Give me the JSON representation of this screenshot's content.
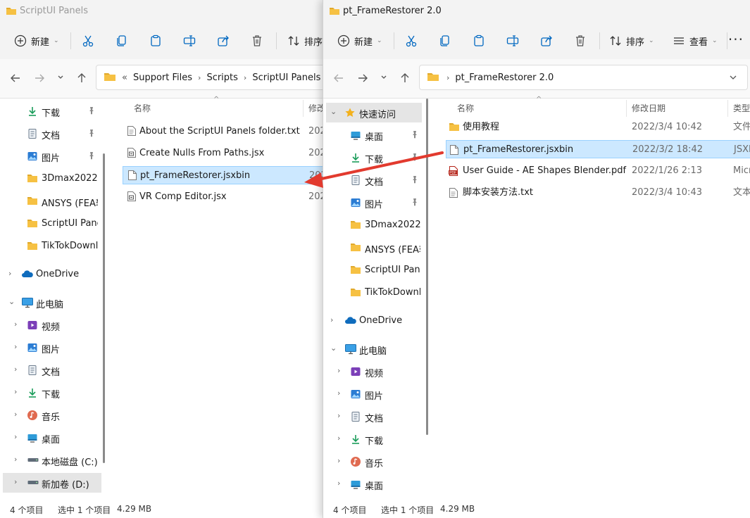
{
  "colors": {
    "accent": "#0078d4",
    "folder": "#f6c143",
    "arrow": "#e23a2e",
    "selection": "#cce8ff"
  },
  "left": {
    "title": "ScriptUI Panels",
    "toolbar": {
      "new_label": "新建",
      "sort_label": "排序"
    },
    "breadcrumb": {
      "prefix": "«",
      "items": [
        "Support Files",
        "Scripts",
        "ScriptUI Panels"
      ]
    },
    "nav": [
      {
        "label": "下载",
        "icon": "download-icon",
        "pinned": true
      },
      {
        "label": "文档",
        "icon": "document-icon",
        "pinned": true
      },
      {
        "label": "图片",
        "icon": "picture-icon",
        "pinned": true
      },
      {
        "label": "3Dmax2022",
        "icon": "folder-icon"
      },
      {
        "label": "ANSYS (FEA软",
        "icon": "folder-icon"
      },
      {
        "label": "ScriptUI Panel",
        "icon": "folder-icon"
      },
      {
        "label": "TikTokDownlc",
        "icon": "folder-icon"
      },
      {
        "label": "OneDrive",
        "icon": "cloud-icon"
      },
      {
        "label": "此电脑",
        "icon": "pc-icon"
      },
      {
        "label": "视频",
        "icon": "video-icon"
      },
      {
        "label": "图片",
        "icon": "picture-icon"
      },
      {
        "label": "文档",
        "icon": "document-icon"
      },
      {
        "label": "下载",
        "icon": "download-icon"
      },
      {
        "label": "音乐",
        "icon": "music-icon"
      },
      {
        "label": "桌面",
        "icon": "desktop-icon"
      },
      {
        "label": "本地磁盘 (C:)",
        "icon": "drive-icon"
      },
      {
        "label": "新加卷 (D:)",
        "icon": "drive-icon"
      }
    ],
    "columns": {
      "name": "名称",
      "modified": "修改"
    },
    "files": [
      {
        "name": "About the ScriptUI Panels folder.txt",
        "date": "202",
        "icon": "text-file-icon"
      },
      {
        "name": "Create Nulls From Paths.jsx",
        "date": "202",
        "icon": "script-file-icon"
      },
      {
        "name": "pt_FrameRestorer.jsxbin",
        "date": "202",
        "icon": "blank-file-icon",
        "selected": true
      },
      {
        "name": "VR Comp Editor.jsx",
        "date": "202",
        "icon": "script-file-icon"
      }
    ],
    "status": {
      "count": "4 个项目",
      "selected": "选中 1 个项目",
      "size": "4.29 MB"
    }
  },
  "right": {
    "title": "pt_FrameRestorer 2.0",
    "toolbar": {
      "new_label": "新建",
      "sort_label": "排序",
      "view_label": "查看"
    },
    "breadcrumb": {
      "items": [
        "pt_FrameRestorer 2.0"
      ]
    },
    "nav": [
      {
        "label": "快速访问",
        "icon": "star-icon"
      },
      {
        "label": "桌面",
        "icon": "desktop-icon",
        "pinned": true
      },
      {
        "label": "下载",
        "icon": "download-icon",
        "pinned": true
      },
      {
        "label": "文档",
        "icon": "document-icon",
        "pinned": true
      },
      {
        "label": "图片",
        "icon": "picture-icon",
        "pinned": true
      },
      {
        "label": "3Dmax2022",
        "icon": "folder-icon"
      },
      {
        "label": "ANSYS (FEA软",
        "icon": "folder-icon"
      },
      {
        "label": "ScriptUI Panel",
        "icon": "folder-icon"
      },
      {
        "label": "TikTokDownlc",
        "icon": "folder-icon"
      },
      {
        "label": "OneDrive",
        "icon": "cloud-icon"
      },
      {
        "label": "此电脑",
        "icon": "pc-icon"
      },
      {
        "label": "视频",
        "icon": "video-icon"
      },
      {
        "label": "图片",
        "icon": "picture-icon"
      },
      {
        "label": "文档",
        "icon": "document-icon"
      },
      {
        "label": "下载",
        "icon": "download-icon"
      },
      {
        "label": "音乐",
        "icon": "music-icon"
      },
      {
        "label": "桌面",
        "icon": "desktop-icon"
      }
    ],
    "columns": {
      "name": "名称",
      "modified": "修改日期",
      "type": "类型"
    },
    "files": [
      {
        "name": "使用教程",
        "date": "2022/3/4 10:42",
        "type": "文件",
        "icon": "folder-icon"
      },
      {
        "name": "pt_FrameRestorer.jsxbin",
        "date": "2022/3/2 18:42",
        "type": "JSXB",
        "icon": "blank-file-icon",
        "selected": true
      },
      {
        "name": "User Guide - AE Shapes Blender.pdf",
        "date": "2022/1/26 2:13",
        "type": "Micr",
        "icon": "pdf-file-icon"
      },
      {
        "name": "脚本安装方法.txt",
        "date": "2022/3/4 10:43",
        "type": "文本",
        "icon": "text-file-icon"
      }
    ],
    "status": {
      "count": "4 个项目",
      "selected": "选中 1 个项目",
      "size": "4.29 MB"
    }
  }
}
